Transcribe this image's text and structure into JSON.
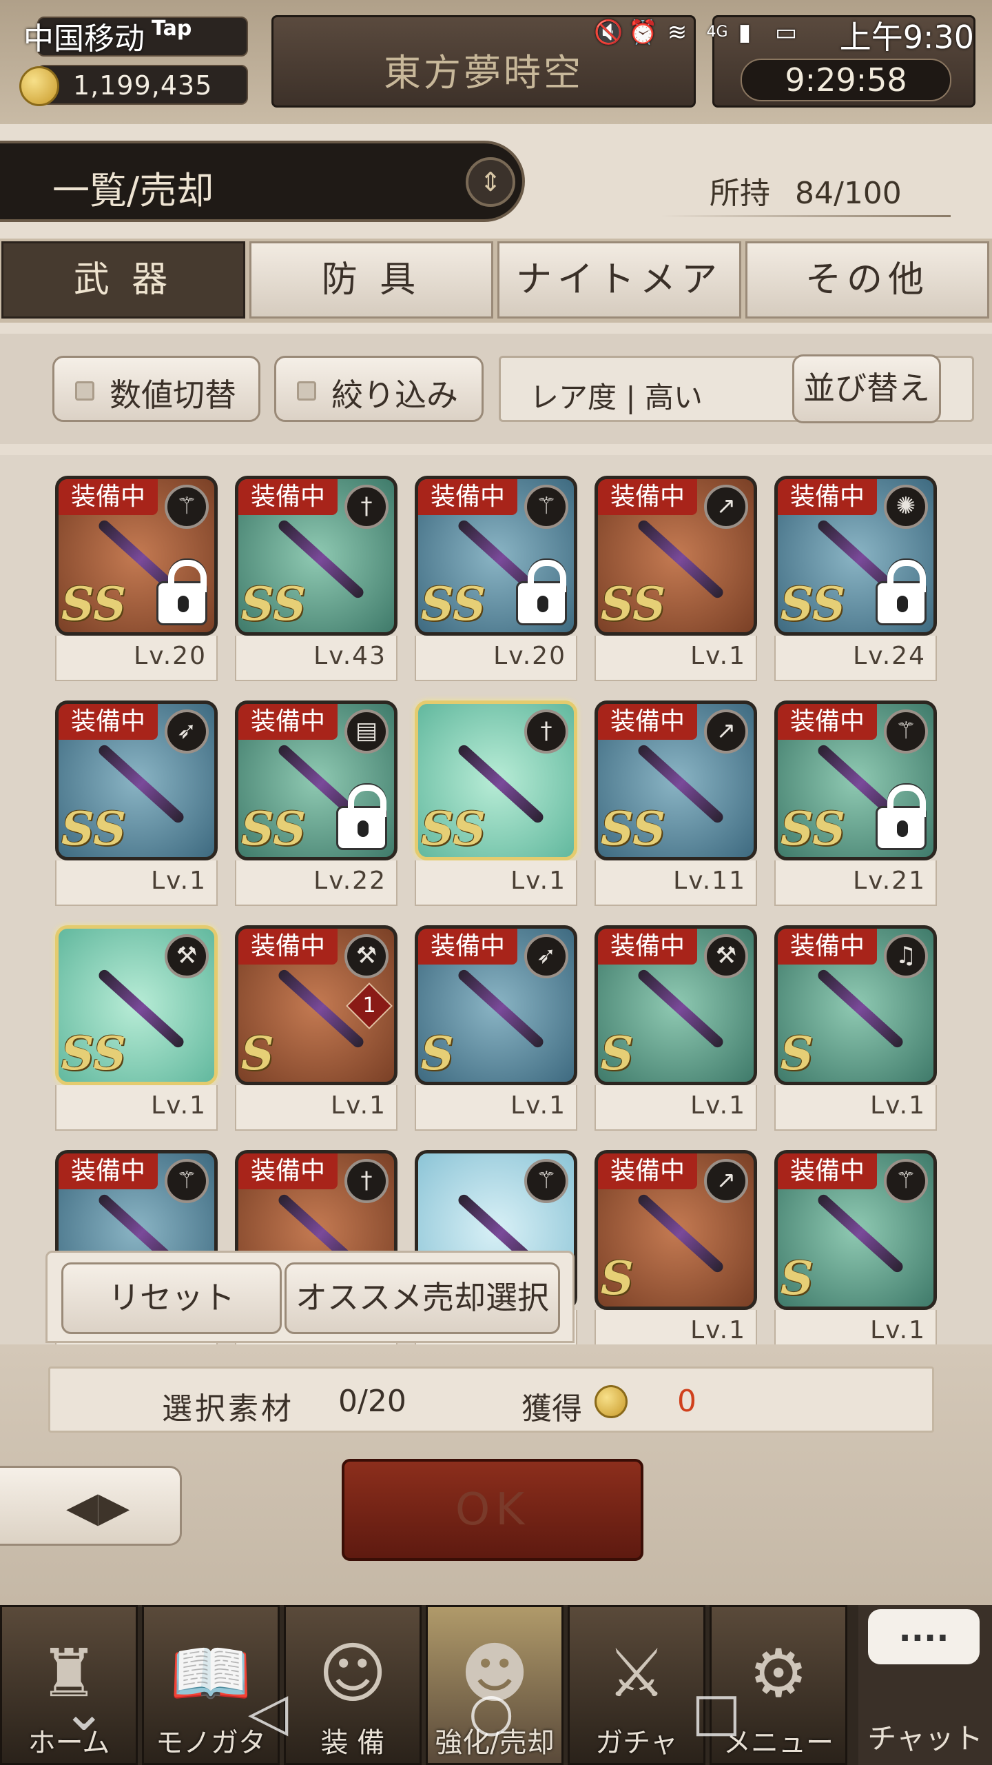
{
  "status_bar": {
    "carrier": "中国移动",
    "app_tag": "Tap",
    "signal": "4G",
    "time": "上午9:30"
  },
  "header": {
    "coins": "1,199,435",
    "title": "東方夢時空",
    "timer": "9:29:58"
  },
  "list_header": {
    "label": "一覧/売却",
    "owned_label": "所持",
    "owned_value": "84/100"
  },
  "tabs": [
    {
      "label": "武 器",
      "active": true
    },
    {
      "label": "防 具",
      "active": false
    },
    {
      "label": "ナイトメア",
      "active": false
    },
    {
      "label": "その他",
      "active": false
    }
  ],
  "filters": {
    "toggle_values": "数値切替",
    "narrow": "絞り込み",
    "rarity": "レア度 | 高い",
    "sort": "並び替え"
  },
  "equipped_badge": "装備中",
  "items": [
    {
      "equipped": true,
      "rank": "SS",
      "level": "Lv.20",
      "locked": true,
      "bg": "orange",
      "type_icon": "staff-icon"
    },
    {
      "equipped": true,
      "rank": "SS",
      "level": "Lv.43",
      "locked": false,
      "bg": "teal",
      "type_icon": "sword-icon"
    },
    {
      "equipped": true,
      "rank": "SS",
      "level": "Lv.20",
      "locked": true,
      "bg": "blue",
      "type_icon": "staff-icon"
    },
    {
      "equipped": true,
      "rank": "SS",
      "level": "Lv.1",
      "locked": false,
      "bg": "orange",
      "type_icon": "spear-icon"
    },
    {
      "equipped": true,
      "rank": "SS",
      "level": "Lv.24",
      "locked": true,
      "bg": "blue",
      "type_icon": "rod-icon"
    },
    {
      "equipped": true,
      "rank": "SS",
      "level": "Lv.1",
      "locked": false,
      "bg": "blue",
      "type_icon": "bow-icon"
    },
    {
      "equipped": true,
      "rank": "SS",
      "level": "Lv.22",
      "locked": true,
      "bg": "teal",
      "type_icon": "tome-icon"
    },
    {
      "equipped": false,
      "rank": "SS",
      "level": "Lv.1",
      "locked": false,
      "bg": "mint",
      "type_icon": "sword-icon",
      "selected": true
    },
    {
      "equipped": true,
      "rank": "SS",
      "level": "Lv.11",
      "locked": false,
      "bg": "blue",
      "type_icon": "spear-icon"
    },
    {
      "equipped": true,
      "rank": "SS",
      "level": "Lv.21",
      "locked": true,
      "bg": "teal",
      "type_icon": "staff-icon"
    },
    {
      "equipped": false,
      "rank": "SS",
      "level": "Lv.1",
      "locked": false,
      "bg": "mint",
      "type_icon": "hammer-icon",
      "selected": true
    },
    {
      "equipped": true,
      "rank": "S",
      "level": "Lv.1",
      "locked": false,
      "bg": "orange",
      "type_icon": "hammer-icon",
      "plus": "1"
    },
    {
      "equipped": true,
      "rank": "S",
      "level": "Lv.1",
      "locked": false,
      "bg": "blue",
      "type_icon": "bow-icon"
    },
    {
      "equipped": true,
      "rank": "S",
      "level": "Lv.1",
      "locked": false,
      "bg": "teal",
      "type_icon": "hammer-icon"
    },
    {
      "equipped": true,
      "rank": "S",
      "level": "Lv.1",
      "locked": false,
      "bg": "teal",
      "type_icon": "harp-icon"
    },
    {
      "equipped": true,
      "rank": "",
      "level": "",
      "locked": false,
      "bg": "blue",
      "type_icon": "staff-icon"
    },
    {
      "equipped": true,
      "rank": "",
      "level": "",
      "locked": false,
      "bg": "orange",
      "type_icon": "sword-icon"
    },
    {
      "equipped": false,
      "rank": "",
      "level": "",
      "locked": false,
      "bg": "sky",
      "type_icon": "staff-icon"
    },
    {
      "equipped": true,
      "rank": "S",
      "level": "Lv.1",
      "locked": false,
      "bg": "orange",
      "type_icon": "spear-icon"
    },
    {
      "equipped": true,
      "rank": "S",
      "level": "Lv.1",
      "locked": false,
      "bg": "teal",
      "type_icon": "staff-icon"
    }
  ],
  "popup": {
    "reset": "リセット",
    "recommend": "オススメ売却選択"
  },
  "summary": {
    "selected_label": "選択素材",
    "selected_value": "0/20",
    "gain_label": "獲得",
    "gain_value": "0"
  },
  "ok_button": "OK",
  "nav": [
    {
      "label": "ホーム",
      "icon": "castle-icon",
      "glyph": "♜"
    },
    {
      "label": "モノガタリ",
      "icon": "book-icon",
      "glyph": "📖"
    },
    {
      "label": "装 備",
      "icon": "puppet-icon",
      "glyph": "☺"
    },
    {
      "label": "強化/売却",
      "icon": "mask-icon",
      "glyph": "☻",
      "active": true
    },
    {
      "label": "ガチャ",
      "icon": "crossed-swords-icon",
      "glyph": "⚔"
    },
    {
      "label": "メニュー",
      "icon": "gears-icon",
      "glyph": "⚙"
    }
  ],
  "chat": {
    "label": "チャット",
    "bubble": "...."
  }
}
